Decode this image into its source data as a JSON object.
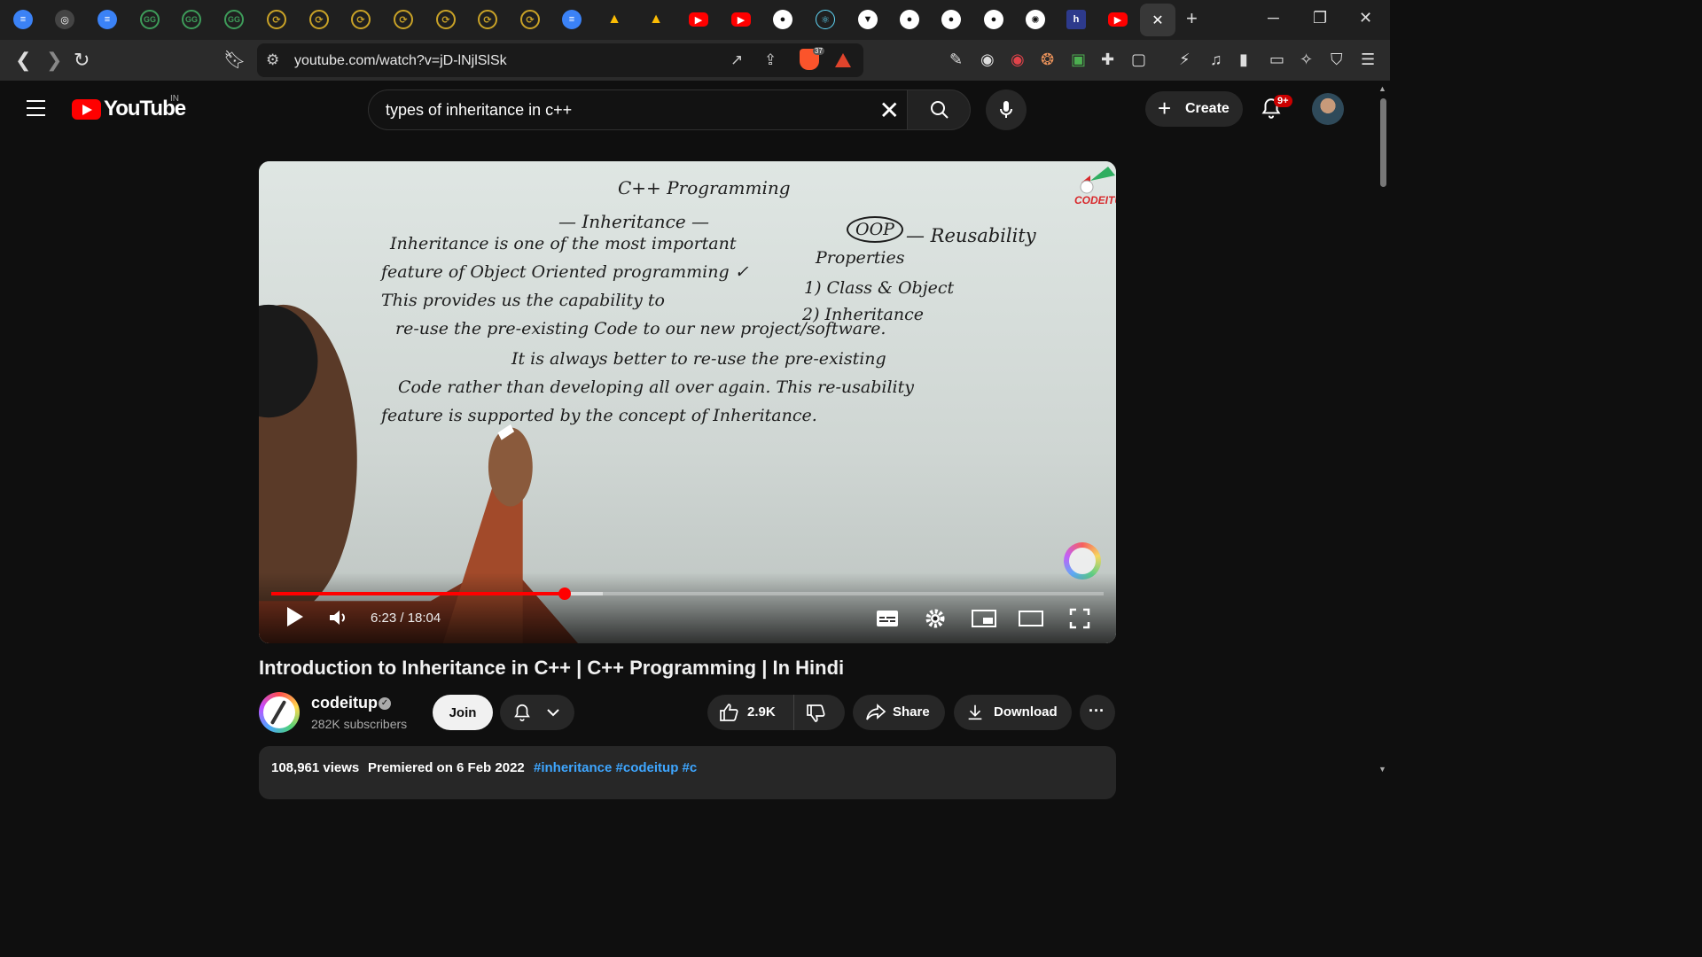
{
  "browser": {
    "active_tab_close": "✕",
    "new_tab": "+",
    "window_minimize": "─",
    "window_restore": "❐",
    "window_close": "✕",
    "url": "youtube.com/watch?v=jD-lNjlSlSk",
    "brave_shield_count": "37"
  },
  "youtube": {
    "logo_text": "YouTube",
    "country_code": "IN",
    "search_query": "types of inheritance in c++",
    "create_label": "Create",
    "notification_count": "9+"
  },
  "player": {
    "current_time": "6:23",
    "duration": "18:04",
    "time_display": "6:23 / 18:04",
    "progress_fraction": 0.353,
    "buffer_fraction": 0.398,
    "watermark": "CODEITUP",
    "whiteboard": {
      "heading": "C++ Programming",
      "subheading": "— Inheritance —",
      "line1": "Inheritance is one of the most important",
      "line2": "feature of Object Oriented programming ✓",
      "line3": "This provides us the capability to",
      "line4": "re-use the pre-existing Code to our new project/software.",
      "line5": "It is always better to re-use the pre-existing",
      "line6": "Code rather than developing all over again. This re-usability",
      "line7": "feature is supported by the concept of Inheritance.",
      "oop": "OOP",
      "reusability": "— Reusability",
      "properties": "Properties",
      "prop1": "1) Class & Object",
      "prop2": "2) Inheritance"
    }
  },
  "video": {
    "title": "Introduction to Inheritance in C++ | C++ Programming | In Hindi",
    "channel_name": "codeitup",
    "subscribers": "282K subscribers",
    "join_label": "Join",
    "likes": "2.9K",
    "share_label": "Share",
    "download_label": "Download",
    "more_label": "···",
    "views": "108,961 views",
    "premiered": "Premiered on 6 Feb 2022",
    "hashtags": "#inheritance #codeitup #c"
  },
  "colors": {
    "background": "#0f0f0f",
    "accent_red": "#ff0000",
    "link_blue": "#3ea6ff",
    "pill_gray": "#272727"
  }
}
